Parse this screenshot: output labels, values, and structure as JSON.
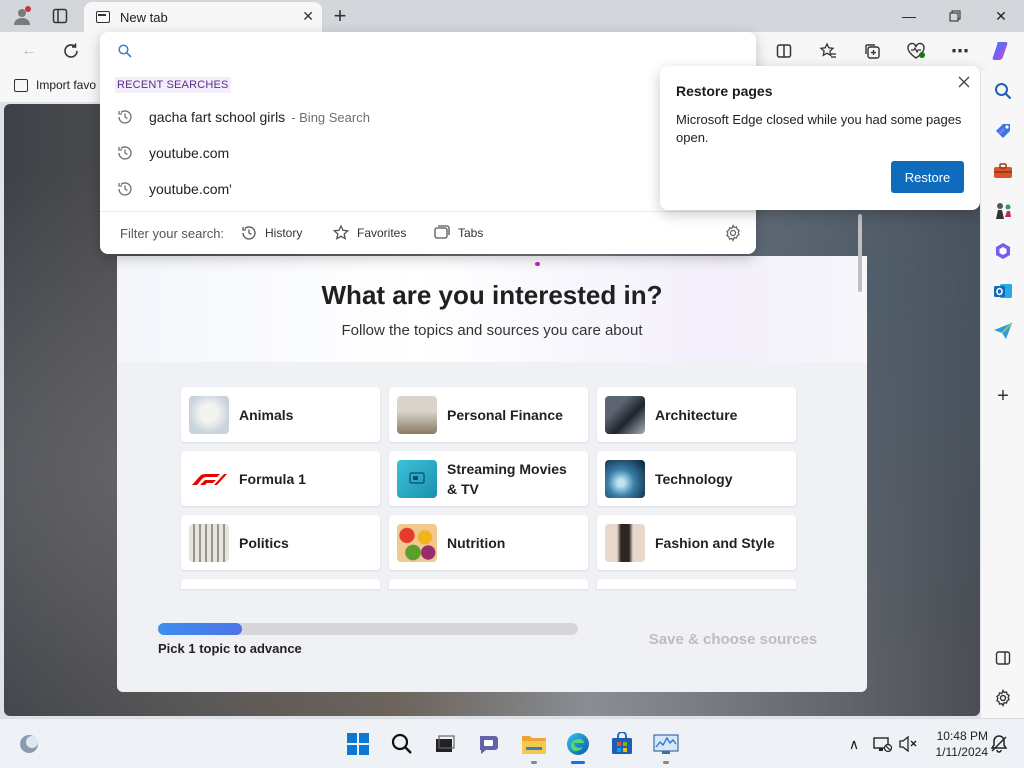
{
  "titlebar": {
    "tab_title": "New tab",
    "new_tab_symbol": "+"
  },
  "favorites_bar": {
    "import_label": "Import favo"
  },
  "address_dropdown": {
    "search_value": "",
    "recent_header": "RECENT SEARCHES",
    "suggestions": [
      {
        "text": "gacha fart school girls",
        "suffix": "- Bing Search"
      },
      {
        "text": "youtube.com",
        "suffix": ""
      },
      {
        "text": "youtube.com'",
        "suffix": ""
      }
    ],
    "filter_label": "Filter your search:",
    "filters": [
      "History",
      "Favorites",
      "Tabs"
    ]
  },
  "restore_popup": {
    "title": "Restore pages",
    "message": "Microsoft Edge closed while you had some pages open.",
    "button": "Restore"
  },
  "interest": {
    "title": "What are you interested in?",
    "subtitle": "Follow the topics and sources you care about",
    "topics": [
      [
        "Animals",
        "Personal Finance",
        "Architecture"
      ],
      [
        "Formula 1",
        "Streaming Movies & TV",
        "Technology"
      ],
      [
        "Politics",
        "Nutrition",
        "Fashion and Style"
      ]
    ],
    "progress_fraction": 0.2,
    "progress_text": "Pick 1 topic to advance",
    "save_button": "Save & choose sources"
  },
  "taskbar": {
    "time": "10:48 PM",
    "date": "1/11/2024"
  },
  "colors": {
    "accent": "#0f6cbd",
    "recent_header": "#5b2b8e",
    "progress": "#3c8ef0"
  }
}
